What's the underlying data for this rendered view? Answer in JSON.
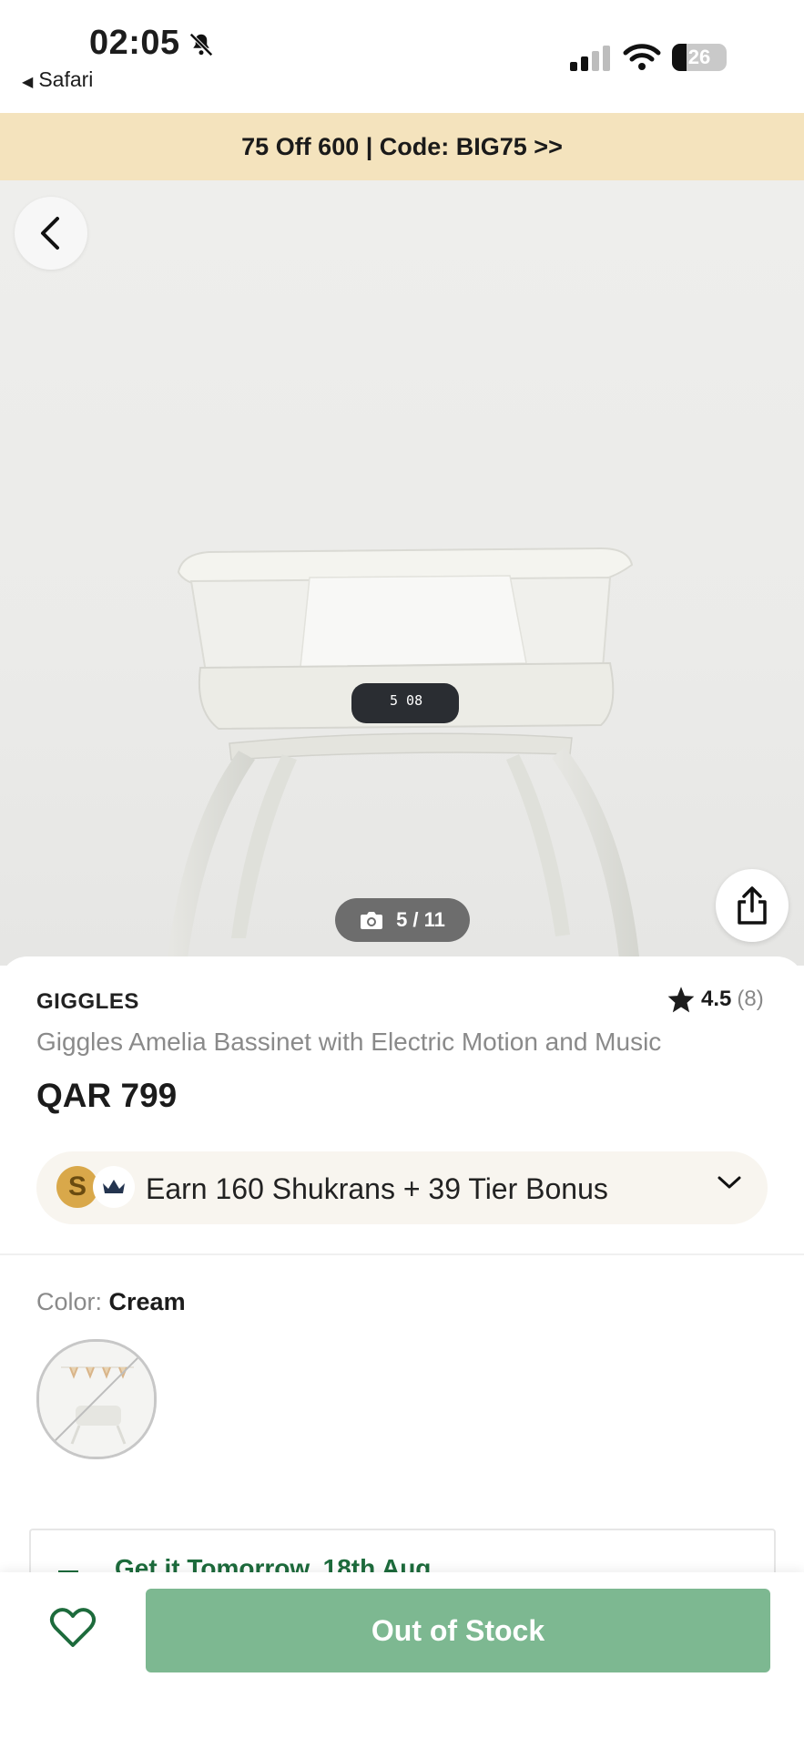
{
  "status_bar": {
    "time": "02:05",
    "back_app": "Safari",
    "battery": "26",
    "battery_level": 0.26
  },
  "promo": {
    "text": "75 Off 600 | Code: BIG75 >>"
  },
  "gallery": {
    "counter": "5 / 11",
    "back_icon": "chevron-left-icon",
    "share_icon": "share-icon",
    "camera_icon": "camera-icon"
  },
  "product": {
    "brand": "GIGGLES",
    "rating": "4.5",
    "rating_count": "(8)",
    "title": "Giggles Amelia Bassinet with Electric Motion and Music",
    "price": "QAR 799"
  },
  "shukran": {
    "coin_letter": "S",
    "text": "Earn 160 Shukrans + 39 Tier Bonus"
  },
  "color": {
    "label": "Color: ",
    "value": "Cream"
  },
  "delivery": {
    "text": "Get it Tomorrow, 18th Aug"
  },
  "footer": {
    "wishlist_icon": "heart-icon",
    "button": "Out of Stock",
    "button_color": "#7db891"
  },
  "colors": {
    "promo_bg": "#f4e3bd",
    "delivery_green": "#1d6b3c"
  }
}
